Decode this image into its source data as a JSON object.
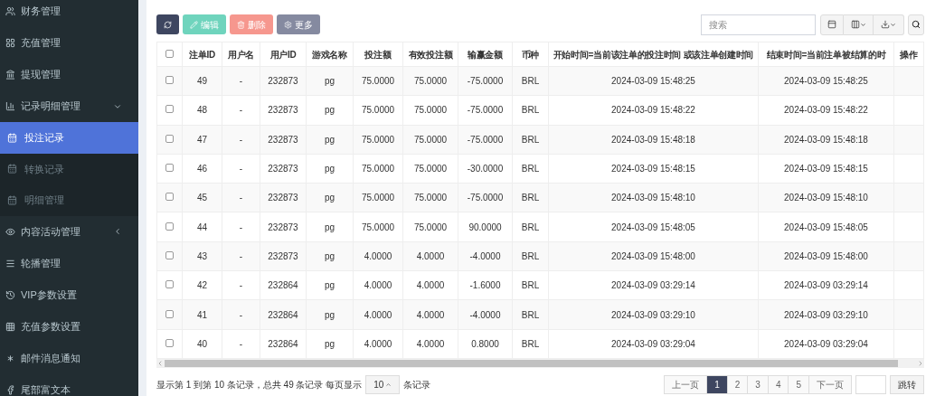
{
  "sidebar": {
    "items": [
      {
        "label": "财务管理",
        "selected": false
      },
      {
        "label": "充值管理",
        "selected": false
      },
      {
        "label": "提现管理",
        "selected": false
      },
      {
        "label": "记录明细管理",
        "selected": false,
        "expanded": true,
        "children": [
          {
            "label": "投注记录",
            "selected": true
          },
          {
            "label": "转换记录",
            "selected": false
          },
          {
            "label": "明细管理",
            "selected": false
          }
        ]
      },
      {
        "label": "内容活动管理",
        "selected": false,
        "expanded": false
      },
      {
        "label": "轮播管理",
        "selected": false
      },
      {
        "label": "VIP参数设置",
        "selected": false
      },
      {
        "label": "充值参数设置",
        "selected": false
      },
      {
        "label": "邮件消息通知",
        "selected": false
      },
      {
        "label": "尾部富文本",
        "selected": false
      }
    ]
  },
  "toolbar": {
    "buttons": [
      {
        "kind": "refresh"
      },
      {
        "kind": "edit",
        "label": "编辑"
      },
      {
        "kind": "delete",
        "label": "删除"
      },
      {
        "kind": "more",
        "label": "更多"
      }
    ],
    "search": {
      "placeholder": "搜索"
    }
  },
  "table": {
    "all_checked": false,
    "columns": [
      "注单ID",
      "用户名",
      "用户ID",
      "游戏名称",
      "投注额",
      "有效投注额",
      "输赢金额",
      "币种",
      "开始时间=当前该注单的投注时间 或该注单创建时间",
      "结束时间=当前注单被结算的时",
      "操作"
    ],
    "rows": [
      {
        "checked": false,
        "cells": [
          "49",
          "-",
          "232873",
          "pg",
          "75.0000",
          "75.0000",
          "-75.0000",
          "BRL",
          "2024-03-09 15:48:25",
          "2024-03-09 15:48:25"
        ]
      },
      {
        "checked": false,
        "cells": [
          "48",
          "-",
          "232873",
          "pg",
          "75.0000",
          "75.0000",
          "-75.0000",
          "BRL",
          "2024-03-09 15:48:22",
          "2024-03-09 15:48:22"
        ]
      },
      {
        "checked": false,
        "cells": [
          "47",
          "-",
          "232873",
          "pg",
          "75.0000",
          "75.0000",
          "-75.0000",
          "BRL",
          "2024-03-09 15:48:18",
          "2024-03-09 15:48:18"
        ]
      },
      {
        "checked": false,
        "cells": [
          "46",
          "-",
          "232873",
          "pg",
          "75.0000",
          "75.0000",
          "-30.0000",
          "BRL",
          "2024-03-09 15:48:15",
          "2024-03-09 15:48:15"
        ]
      },
      {
        "checked": false,
        "cells": [
          "45",
          "-",
          "232873",
          "pg",
          "75.0000",
          "75.0000",
          "-75.0000",
          "BRL",
          "2024-03-09 15:48:10",
          "2024-03-09 15:48:10"
        ]
      },
      {
        "checked": false,
        "cells": [
          "44",
          "-",
          "232873",
          "pg",
          "75.0000",
          "75.0000",
          "90.0000",
          "BRL",
          "2024-03-09 15:48:05",
          "2024-03-09 15:48:05"
        ]
      },
      {
        "checked": false,
        "cells": [
          "43",
          "-",
          "232873",
          "pg",
          "4.0000",
          "4.0000",
          "-4.0000",
          "BRL",
          "2024-03-09 15:48:00",
          "2024-03-09 15:48:00"
        ]
      },
      {
        "checked": false,
        "cells": [
          "42",
          "-",
          "232864",
          "pg",
          "4.0000",
          "4.0000",
          "-1.6000",
          "BRL",
          "2024-03-09 03:29:14",
          "2024-03-09 03:29:14"
        ]
      },
      {
        "checked": false,
        "cells": [
          "41",
          "-",
          "232864",
          "pg",
          "4.0000",
          "4.0000",
          "-4.0000",
          "BRL",
          "2024-03-09 03:29:10",
          "2024-03-09 03:29:10"
        ]
      },
      {
        "checked": false,
        "cells": [
          "40",
          "-",
          "232864",
          "pg",
          "4.0000",
          "4.0000",
          "0.8000",
          "BRL",
          "2024-03-09 03:29:04",
          "2024-03-09 03:29:04"
        ]
      }
    ]
  },
  "footer": {
    "summary": "显示第 1 到第 10 条记录，总共 49 条记录 每页显示",
    "page_size": "10",
    "suffix": "条记录",
    "pages": [
      {
        "label": "上一页",
        "selected": false
      },
      {
        "label": "1",
        "selected": true
      },
      {
        "label": "2",
        "selected": false
      },
      {
        "label": "3",
        "selected": false
      },
      {
        "label": "4",
        "selected": false
      },
      {
        "label": "5",
        "selected": false
      },
      {
        "label": "下一页",
        "selected": false
      }
    ],
    "jump": "跳转"
  }
}
